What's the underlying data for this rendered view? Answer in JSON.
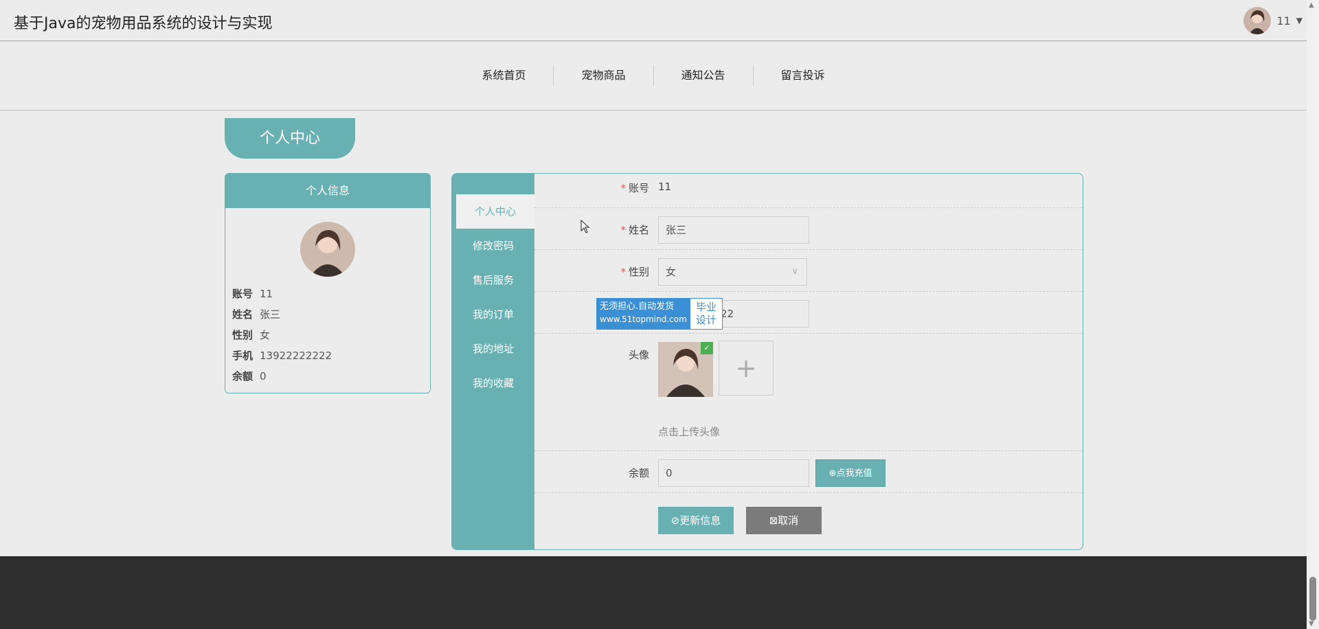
{
  "header": {
    "title": "基于Java的宠物用品系统的设计与实现",
    "user_name": "11"
  },
  "nav": {
    "items": [
      "系统首页",
      "宠物商品",
      "通知公告",
      "留言投诉"
    ]
  },
  "section_title": "个人中心",
  "info_card": {
    "title": "个人信息",
    "rows": [
      {
        "label": "账号",
        "value": "11"
      },
      {
        "label": "姓名",
        "value": "张三"
      },
      {
        "label": "性别",
        "value": "女"
      },
      {
        "label": "手机",
        "value": "13922222222"
      },
      {
        "label": "余额",
        "value": "0"
      }
    ]
  },
  "side_menu": {
    "items": [
      "个人中心",
      "修改密码",
      "售后服务",
      "我的订单",
      "我的地址",
      "我的收藏"
    ],
    "active": "个人中心"
  },
  "form": {
    "account_label": "账号",
    "account_value": "11",
    "name_label": "姓名",
    "name_value": "张三",
    "gender_label": "性别",
    "gender_value": "女",
    "phone_value_partial": "22",
    "avatar_label": "头像",
    "upload_hint": "点击上传头像",
    "balance_label": "余额",
    "balance_value": "0",
    "recharge_button": "点我充值",
    "update_button": "更新信息",
    "cancel_button": "取消"
  },
  "watermark": {
    "line1": "无须担心.自动发货",
    "url": "www.51topmind.com",
    "right1": "毕业",
    "right2": "设计"
  },
  "colors": {
    "accent": "#69b0b3",
    "footer": "#2e2e2e",
    "cancel": "#7b7b7b"
  }
}
